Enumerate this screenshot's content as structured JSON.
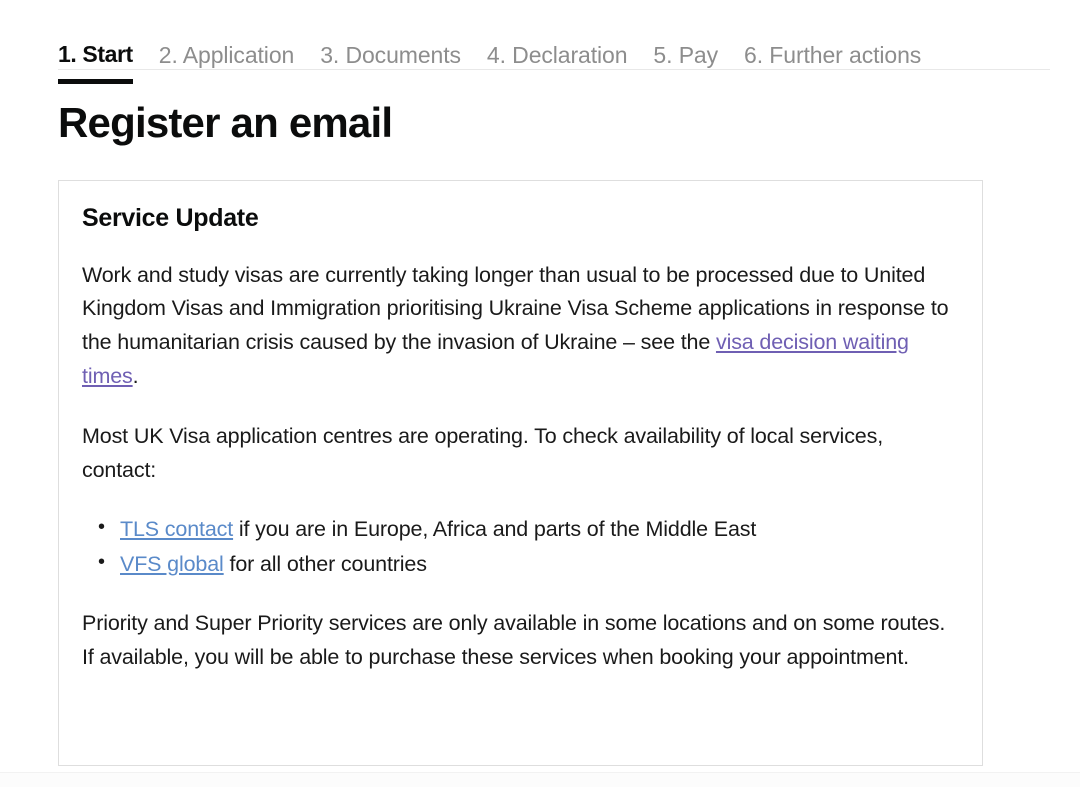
{
  "steps": {
    "items": [
      {
        "label": "1. Start",
        "active": true
      },
      {
        "label": "2. Application",
        "active": false
      },
      {
        "label": "3. Documents",
        "active": false
      },
      {
        "label": "4. Declaration",
        "active": false
      },
      {
        "label": "5. Pay",
        "active": false
      },
      {
        "label": "6. Further actions",
        "active": false
      }
    ]
  },
  "page": {
    "title": "Register an email"
  },
  "panel": {
    "title": "Service Update",
    "paragraph1_before_link": "Work and study visas are currently taking longer than usual to be processed due to United Kingdom Visas and Immigration prioritising Ukraine Visa Scheme applications in response to the humanitarian crisis caused by the invasion of Ukraine – see the ",
    "paragraph1_link": "visa decision waiting times",
    "paragraph1_after_link": ".",
    "paragraph2": "Most UK Visa application centres are operating. To check availability of local services, contact:",
    "bullets": [
      {
        "link": "TLS contact",
        "text": " if you are in Europe, Africa and parts of the Middle East"
      },
      {
        "link": "VFS global",
        "text": " for all other countries"
      }
    ],
    "paragraph3": "Priority and Super Priority services are only available in some locations and on some routes. If available, you will be able to purchase these services when booking your appointment."
  },
  "colors": {
    "text": "#0b0c0c",
    "muted_tab": "#8d8d8d",
    "link_visited": "#6f5fb3",
    "link_default": "#5a8ac9",
    "panel_border": "#dedede",
    "background": "#ffffff"
  }
}
